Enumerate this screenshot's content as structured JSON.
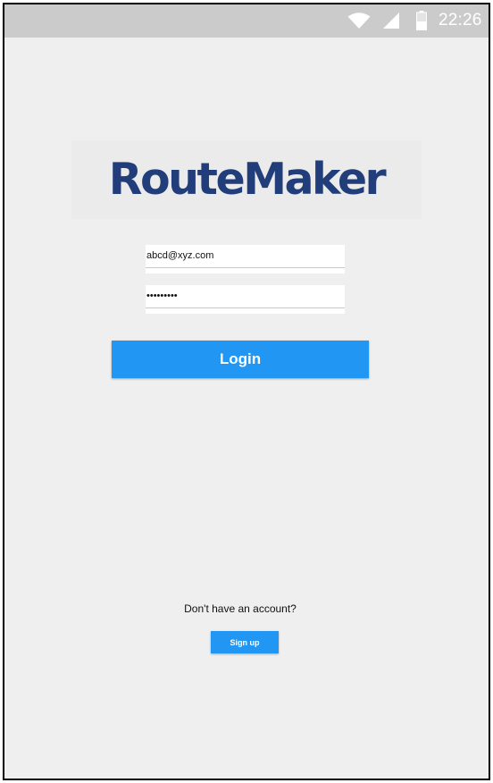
{
  "status_bar": {
    "time": "22:26",
    "icons": [
      "wifi-icon",
      "cellular-signal-icon",
      "battery-icon"
    ]
  },
  "logo": {
    "text": "RouteMaker"
  },
  "login_form": {
    "email": {
      "value": "abcd@xyz.com"
    },
    "password": {
      "value": "abcdefghi"
    },
    "login_label": "Login"
  },
  "signup": {
    "prompt": "Don't have an account?",
    "button_label": "Sign up"
  },
  "colors": {
    "accent": "#2196f3",
    "logo": "#213d7a",
    "background": "#efefef",
    "status_bar": "#cbcbcb"
  }
}
